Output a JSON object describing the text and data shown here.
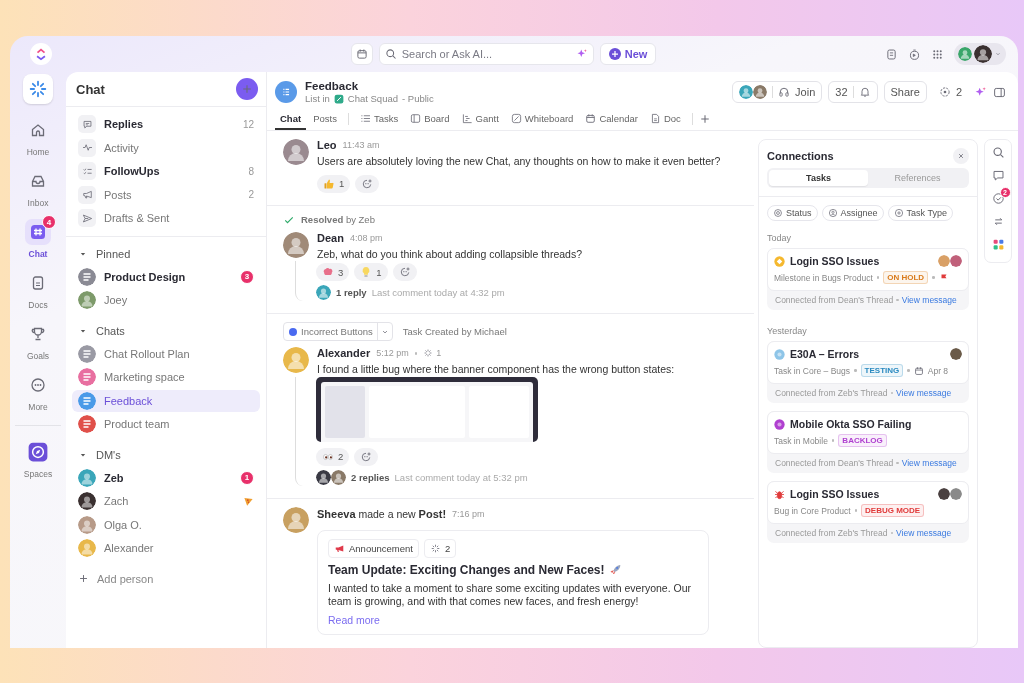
{
  "topbar": {
    "search": {
      "placeholder": "Search or Ask AI..."
    },
    "new_button": "New"
  },
  "rail": {
    "items": [
      {
        "label": "Home",
        "kind": "home",
        "selected": false
      },
      {
        "label": "Inbox",
        "kind": "inbox",
        "selected": false
      },
      {
        "label": "Chat",
        "kind": "chat",
        "selected": true,
        "badge": "4"
      },
      {
        "label": "Docs",
        "kind": "docs",
        "selected": false
      },
      {
        "label": "Goals",
        "kind": "goals",
        "selected": false
      },
      {
        "label": "More",
        "kind": "more",
        "selected": false
      }
    ],
    "spaces": {
      "label": "Spaces"
    }
  },
  "sidebar": {
    "title": "Chat",
    "top_items": [
      {
        "label": "Replies",
        "kind": "replies",
        "unread": true,
        "count": "12"
      },
      {
        "label": "Activity",
        "kind": "activity",
        "unread": false
      },
      {
        "label": "FollowUps",
        "kind": "followups",
        "unread": true,
        "count": "8"
      },
      {
        "label": "Posts",
        "kind": "posts",
        "unread": false,
        "count": "2"
      },
      {
        "label": "Drafts & Sent",
        "kind": "drafts",
        "unread": false
      }
    ],
    "sections": [
      {
        "title": "Pinned",
        "expanded": true,
        "items": [
          {
            "label": "Product Design",
            "kind": "channel",
            "color": "#8a8a94",
            "unread": true,
            "selected": false,
            "badge": "3"
          },
          {
            "label": "Joey",
            "kind": "person",
            "color": "#7d9a6a",
            "unread": false,
            "selected": false
          }
        ]
      },
      {
        "title": "Chats",
        "expanded": true,
        "items": [
          {
            "label": "Chat Rollout Plan",
            "kind": "channel",
            "color": "#9a9aa4",
            "unread": false,
            "selected": false
          },
          {
            "label": "Marketing space",
            "kind": "channel",
            "color": "#e86fa0",
            "unread": false,
            "selected": false
          },
          {
            "label": "Feedback",
            "kind": "channel",
            "color": "#4a9ae8",
            "unread": false,
            "selected": true
          },
          {
            "label": "Product team",
            "kind": "channel",
            "color": "#e0504a",
            "unread": false,
            "selected": false
          }
        ]
      },
      {
        "title": "DM's",
        "expanded": true,
        "items": [
          {
            "label": "Zeb",
            "kind": "person",
            "color": "#3aa6b9",
            "unread": true,
            "selected": false,
            "badge": "1"
          },
          {
            "label": "Zach",
            "kind": "person",
            "color": "#3a3030",
            "unread": false,
            "selected": false,
            "pizza": true
          },
          {
            "label": "Olga O.",
            "kind": "person",
            "color": "#b79a88",
            "unread": false,
            "selected": false
          },
          {
            "label": "Alexander",
            "kind": "person",
            "color": "#e8b84a",
            "unread": false,
            "selected": false
          }
        ]
      }
    ],
    "add_person": "Add person"
  },
  "header": {
    "title": "Feedback",
    "location_prefix": "List in",
    "space": "Chat Squad",
    "visibility": "- Public",
    "join": "Join",
    "count": "32",
    "share": "Share",
    "watchers": "2",
    "tabs": [
      {
        "label": "Chat",
        "kind": "chat",
        "selected": true
      },
      {
        "label": "Posts",
        "kind": "posts",
        "selected": false
      },
      {
        "label": "Tasks",
        "kind": "list",
        "selected": false
      },
      {
        "label": "Board",
        "kind": "board",
        "selected": false
      },
      {
        "label": "Gantt",
        "kind": "gantt",
        "selected": false
      },
      {
        "label": "Whiteboard",
        "kind": "whiteboard",
        "selected": false
      },
      {
        "label": "Calendar",
        "kind": "calendar",
        "selected": false
      },
      {
        "label": "Doc",
        "kind": "doc",
        "selected": false
      }
    ]
  },
  "messages": [
    {
      "kind": "message",
      "author": "Leo",
      "color": "#9a8a90",
      "time": "11:43 am",
      "text": "Users are absolutely loving the new Chat, any thoughts on how to make it even better?",
      "reactions": [
        {
          "kind": "thumbs-up",
          "count": "1"
        }
      ]
    },
    {
      "kind": "message",
      "resolved": "**Resolved** by Zeb",
      "author": "Dean",
      "color": "#a08a78",
      "time": "4:08 pm",
      "text": "Zeb, what do you think about adding collapsible threads?",
      "reactions": [
        {
          "kind": "brain",
          "count": "3"
        },
        {
          "kind": "bulb",
          "count": "1"
        }
      ],
      "thread": {
        "avatars": [
          {
            "color": "#3aa6b9"
          }
        ],
        "replies": "1 reply",
        "last": "Last comment today at 4:32 pm"
      }
    },
    {
      "kind": "message",
      "task_chip": {
        "label": "Incorrect Buttons",
        "note": "Task Created by Michael"
      },
      "author": "Alexander",
      "color": "#e8b84a",
      "time": "5:12 pm",
      "subtasks": "1",
      "text": "I found a little bug where the banner component has the wrong button states:",
      "attachment": {
        "kind": "screenshot"
      },
      "reactions": [
        {
          "kind": "eyes",
          "count": "2"
        }
      ],
      "thread": {
        "avatars": [
          {
            "color": "#3a3a44"
          },
          {
            "color": "#8a7a68"
          }
        ],
        "replies": "2 replies",
        "last": "Last comment today at 5:32 pm"
      }
    },
    {
      "kind": "post",
      "headline": "**Sheeva** made a new **Post!**",
      "color": "#c8a060",
      "time": "7:16 pm",
      "post": {
        "tag": "Announcement",
        "subtasks": "2",
        "title": "Team Update: Exciting Changes and New Faces!",
        "body": "I wanted to take a moment to share some exciting updates with everyone. Our team is growing, and with that comes new faces, and fresh energy!",
        "link": "Read more"
      }
    }
  ],
  "connections": {
    "title": "Connections",
    "tabs": [
      {
        "label": "Tasks",
        "selected": true
      },
      {
        "label": "References",
        "selected": false
      }
    ],
    "filters": [
      {
        "label": "Status",
        "kind": "status"
      },
      {
        "label": "Assignee",
        "kind": "assignee"
      },
      {
        "label": "Task Type",
        "kind": "type"
      }
    ],
    "groups": [
      {
        "label": "Today",
        "tasks": [
          {
            "title": "Login SSO Issues",
            "kind": "milestone",
            "color": "#f5b82e",
            "meta": "Milestone in Bugs Product",
            "status": {
              "label": "ON HOLD",
              "color": "#d97a1a"
            },
            "flagged": true,
            "assignees": [
              {
                "color": "#d9a066"
              },
              {
                "color": "#c0607a"
              }
            ],
            "connected": "Connected from Dean's Thread",
            "link": "View message"
          }
        ]
      },
      {
        "label": "Yesterday",
        "tasks": [
          {
            "title": "E30A – Errors",
            "kind": "task",
            "color": "#8ec5e8",
            "meta": "Task in Core – Bugs",
            "status": {
              "label": "TESTING",
              "color": "#2a8ac0"
            },
            "flagged": false,
            "due": "Apr 8",
            "assignees": [
              {
                "color": "#6a5a48"
              }
            ],
            "connected": "Connected from Zeb's Thread",
            "link": "View message"
          },
          {
            "title": "Mobile Okta SSO Failing",
            "kind": "task",
            "color": "#b040d0",
            "meta": "Task in Mobile",
            "status": {
              "label": "BACKLOG",
              "color": "#b040d0"
            },
            "flagged": false,
            "connected": "Connected from Dean's Thread",
            "link": "View message"
          },
          {
            "title": "Login SSO Issues",
            "kind": "bug",
            "color": "#e03a3a",
            "meta": "Bug in Core Product",
            "status": {
              "label": "DEBUG MODE",
              "color": "#e03a3a"
            },
            "flagged": false,
            "assignees": [
              {
                "color": "#4a4040"
              },
              {
                "color": "#8a8a8a"
              }
            ],
            "connected": "Connected from Zeb's Thread",
            "link": "View message"
          }
        ]
      }
    ]
  },
  "side_rail": {
    "badge": "2"
  }
}
